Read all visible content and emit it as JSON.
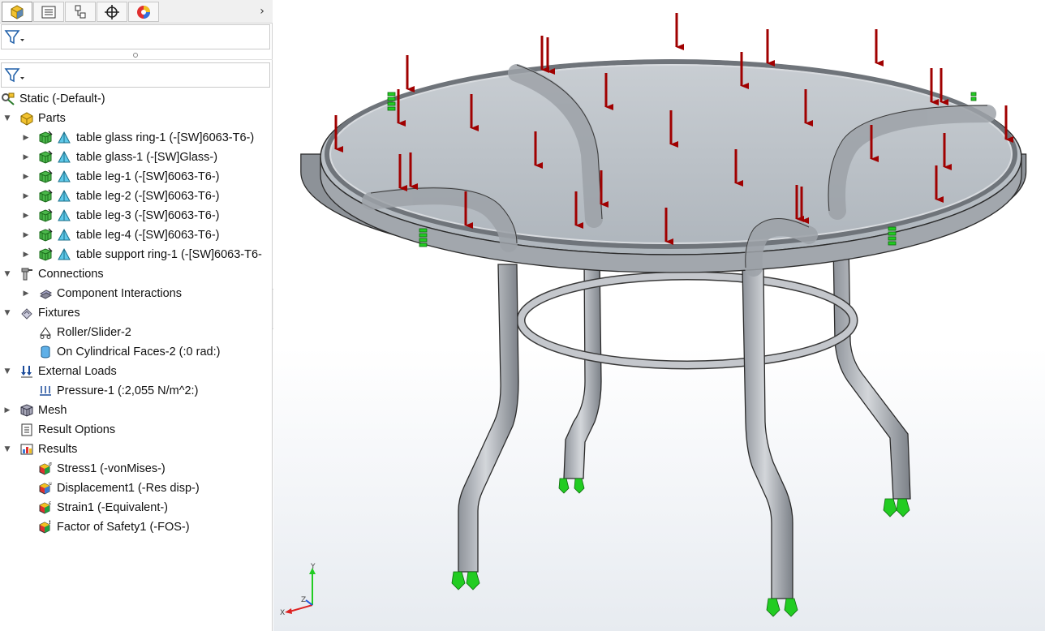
{
  "tree": {
    "study": "Static (-Default-)",
    "parts": {
      "label": "Parts",
      "items": [
        "table glass ring-1 (-[SW]6063-T6-)",
        "table glass-1 (-[SW]Glass-)",
        "table leg-1 (-[SW]6063-T6-)",
        "table leg-2 (-[SW]6063-T6-)",
        "table leg-3 (-[SW]6063-T6-)",
        "table leg-4 (-[SW]6063-T6-)",
        "table support ring-1 (-[SW]6063-T6-"
      ]
    },
    "connections": {
      "label": "Connections",
      "child": "Component Interactions"
    },
    "fixtures": {
      "label": "Fixtures",
      "items": [
        "Roller/Slider-2",
        "On Cylindrical Faces-2 (:0 rad:)"
      ]
    },
    "external_loads": {
      "label": "External Loads",
      "items": [
        "Pressure-1 (:2,055 N/m^2:)"
      ]
    },
    "mesh": "Mesh",
    "result_options": "Result Options",
    "results": {
      "label": "Results",
      "items": [
        "Stress1 (-vonMises-)",
        "Displacement1 (-Res disp-)",
        "Strain1 (-Equivalent-)",
        "Factor of Safety1 (-FOS-)"
      ]
    }
  },
  "triad": {
    "y": "Y",
    "x": "X",
    "z": "Z"
  },
  "colors": {
    "load_arrow": "#a00000",
    "fixture": "#22cc22",
    "metal": "#b8bcc2",
    "glass": "#bcc3ca"
  },
  "icons": [
    "featuremanager-icon",
    "propertymanager-icon",
    "configurationmanager-icon",
    "dimxpert-icon",
    "display-manager-icon",
    "filter-icon",
    "chevron-right-icon"
  ]
}
